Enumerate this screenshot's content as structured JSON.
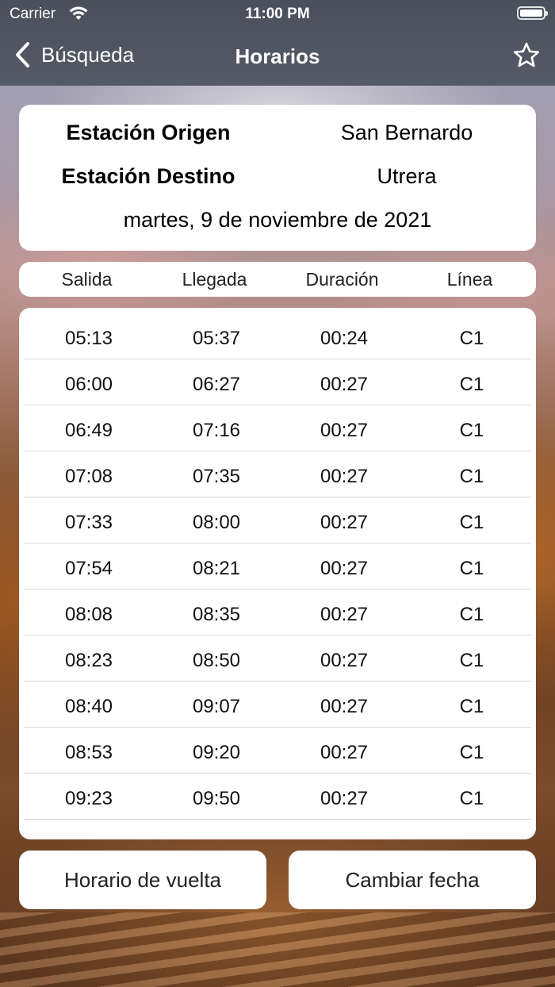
{
  "status_bar": {
    "carrier": "Carrier",
    "time": "11:00 PM",
    "wifi_icon": "wifi-icon",
    "battery_icon": "battery-icon"
  },
  "nav": {
    "back_label": "Búsqueda",
    "title": "Horarios",
    "back_icon": "chevron-left-icon",
    "favorite_icon": "star-outline-icon"
  },
  "route": {
    "origin_label": "Estación Origen",
    "origin_value": "San Bernardo",
    "destination_label": "Estación Destino",
    "destination_value": "Utrera",
    "date": "martes, 9 de noviembre de 2021"
  },
  "table": {
    "columns": [
      "Salida",
      "Llegada",
      "Duración",
      "Línea"
    ],
    "rows": [
      [
        "05:13",
        "05:37",
        "00:24",
        "C1"
      ],
      [
        "06:00",
        "06:27",
        "00:27",
        "C1"
      ],
      [
        "06:49",
        "07:16",
        "00:27",
        "C1"
      ],
      [
        "07:08",
        "07:35",
        "00:27",
        "C1"
      ],
      [
        "07:33",
        "08:00",
        "00:27",
        "C1"
      ],
      [
        "07:54",
        "08:21",
        "00:27",
        "C1"
      ],
      [
        "08:08",
        "08:35",
        "00:27",
        "C1"
      ],
      [
        "08:23",
        "08:50",
        "00:27",
        "C1"
      ],
      [
        "08:40",
        "09:07",
        "00:27",
        "C1"
      ],
      [
        "08:53",
        "09:20",
        "00:27",
        "C1"
      ],
      [
        "09:23",
        "09:50",
        "00:27",
        "C1"
      ]
    ]
  },
  "buttons": {
    "return_schedule": "Horario de vuelta",
    "change_date": "Cambiar fecha"
  },
  "colors": {
    "nav_background": "#4a4f5c",
    "card_background": "#ffffff",
    "row_divider": "#d8d8dc"
  }
}
